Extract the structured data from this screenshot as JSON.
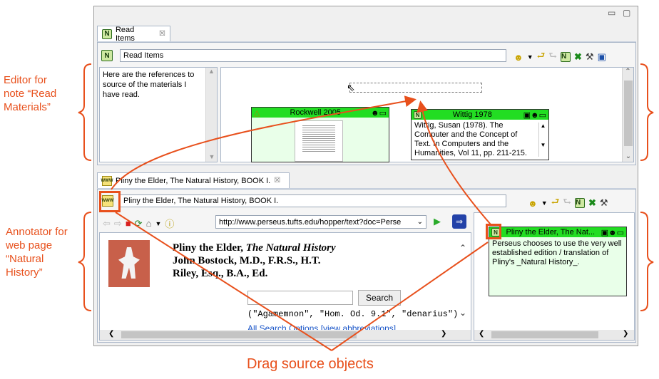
{
  "annotations": {
    "editor": [
      "Editor for",
      "note “Read",
      "Materials”"
    ],
    "annotator": [
      "Annotator for",
      "web page",
      "“Natural",
      "History”"
    ],
    "drag": "Drag source objects"
  },
  "window": {
    "minimize": "▭",
    "maximize": "▢"
  },
  "editor": {
    "tab_label": "Read Items",
    "tab_close": "☒",
    "title_value": "Read Items",
    "description": "Here are the references to source of the materials I have read.",
    "notes": [
      {
        "title": "Rockwell 2005"
      },
      {
        "title": "Wittig 1978",
        "body": "Wittig, Susan (1978). The Computer and the Concept of Text. In Computers and the Humanities, Vol 11, pp. 211-215."
      }
    ]
  },
  "annotator": {
    "tab_label": "Pliny the Elder, The Natural History, BOOK I.",
    "tab_close": "☒",
    "title_value": "Pliny the Elder, The Natural History, BOOK I.",
    "url": "http://www.perseus.tufts.edu/hopper/text?doc=Perse",
    "page": {
      "title_normal": "Pliny the Elder, ",
      "title_italic": "The Natural History",
      "line2": "John Bostock, M.D., F.R.S., H.T.",
      "line3": "Riley, Esq., B.A., Ed.",
      "search_label": "Search",
      "examples": "(\"Agamemnon\", \"Hom. Od. 9.1\", \"denarius\")",
      "link": "All Search Options [view abbreviations]"
    },
    "note": {
      "title": "Pliny the Elder, The Nat...",
      "body": "Perseus chooses to use the very well established edition / translation of Pliny's _Natural History_."
    }
  },
  "colors": {
    "accent": "#e8501c",
    "note_green": "#22dd22",
    "note_bg": "#e9ffe9"
  }
}
